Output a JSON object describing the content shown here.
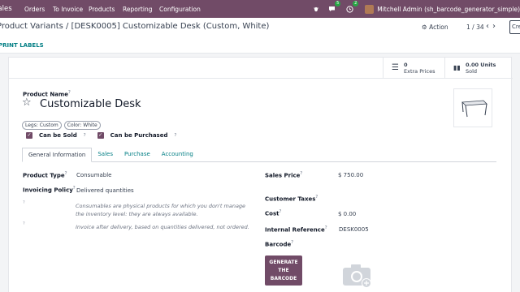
{
  "navbar": {
    "app_name": "Sales",
    "menus": [
      "Orders",
      "To Invoice",
      "Products",
      "Reporting",
      "Configuration"
    ],
    "messages_count": "5",
    "activities_count": "2",
    "user": "Mitchell Admin (sh_barcode_generator_simple)"
  },
  "control": {
    "breadcrumb": "Product Variants / [DESK0005] Customizable Desk (Custom, White)",
    "action": "Action",
    "pager": "1 / 34",
    "create": "Create",
    "print_labels": "PRINT LABELS"
  },
  "stats": {
    "extra_prices_count": "0",
    "extra_prices_label": "Extra Prices",
    "units_sold_count": "0.00 Units",
    "units_sold_label": "Sold"
  },
  "form": {
    "product_name_label": "Product Name",
    "product_name": "Customizable Desk",
    "tags": [
      "Legs: Custom",
      "Color: White"
    ],
    "can_be_sold": "Can be Sold",
    "can_be_purchased": "Can be Purchased",
    "tabs": [
      "General Information",
      "Sales",
      "Purchase",
      "Accounting"
    ],
    "product_type_label": "Product Type",
    "product_type": "Consumable",
    "invoicing_policy_label": "Invoicing Policy",
    "invoicing_policy": "Delivered quantities",
    "note_consumable": "Consumables are physical products for which you don't manage the inventory level: they are always available.",
    "note_invoice": "Invoice after delivery, based on quantities delivered, not ordered.",
    "sales_price_label": "Sales Price",
    "sales_price": "$ 750.00",
    "customer_taxes_label": "Customer Taxes",
    "cost_label": "Cost",
    "cost": "$ 0.00",
    "internal_ref_label": "Internal Reference",
    "internal_ref": "DESK0005",
    "barcode_label": "Barcode",
    "generate_barcode": "GENERATE THE BARCODE",
    "help_mark": "?"
  },
  "colors": {
    "brand": "#714b67",
    "link": "#017e84"
  }
}
